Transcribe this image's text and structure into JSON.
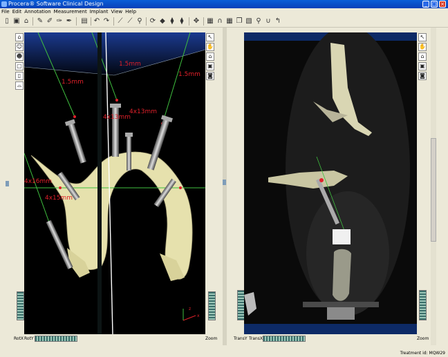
{
  "window": {
    "title": "Procera® Software Clinical Design",
    "minimize": "_",
    "maximize": "□",
    "close": "×"
  },
  "menu": [
    "File",
    "Edit",
    "Annotation",
    "Measurement",
    "Implant",
    "View",
    "Help"
  ],
  "left_view": {
    "bottom_left_label1": "RotX",
    "bottom_left_label2": "RotY",
    "bottom_right_label": "Zoom",
    "annotations": [
      "1.5mm",
      "1.5mm",
      "1.5mm",
      "4x13mm",
      "4x13mm",
      "4x16mm",
      "4x15mm"
    ],
    "axis_z": "z",
    "axis_x": "x"
  },
  "right_view": {
    "bottom_left_label1": "TransY",
    "bottom_left_label2": "TransX",
    "bottom_right_label": "Zoom"
  },
  "status": {
    "treatment": "Treatment id: MQW29"
  },
  "colors": {
    "titlebar": "#0a5fd8",
    "annotation": "#e0202a",
    "bone": "#e8e3b0",
    "guide_line": "#3fbf3f"
  }
}
